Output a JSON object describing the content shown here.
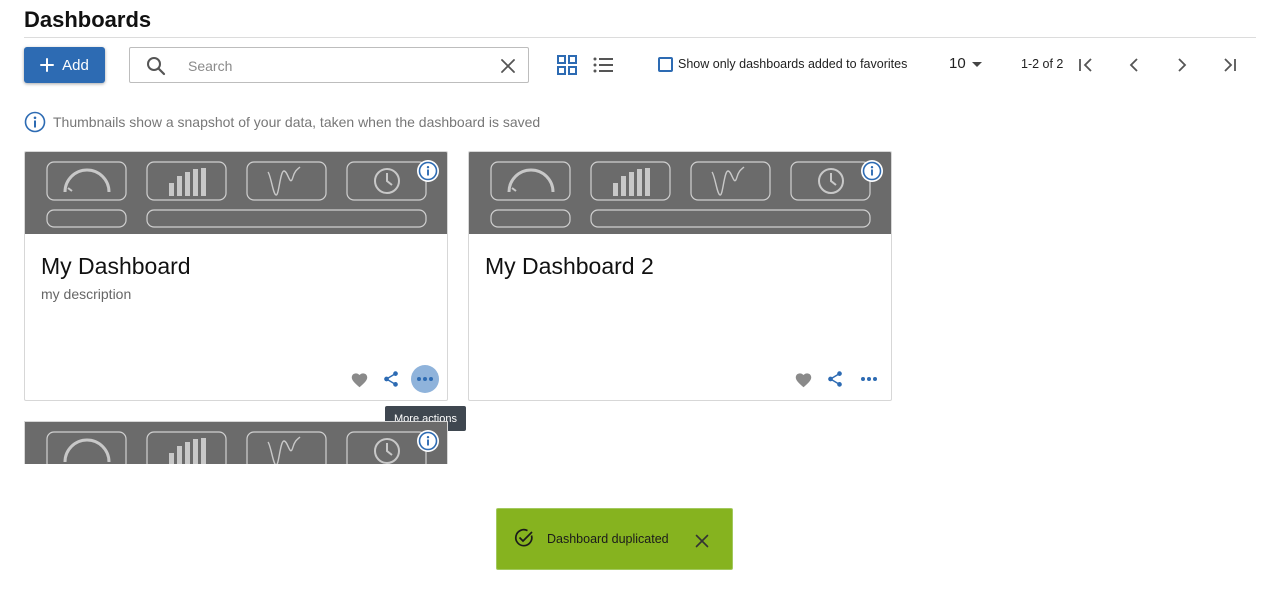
{
  "header": {
    "title": "Dashboards"
  },
  "toolbar": {
    "add_label": "Add",
    "search_placeholder": "Search",
    "search_value": "",
    "favorites_label": "Show only dashboards added to favorites",
    "favorites_checked": false,
    "page_size": "10",
    "page_range": "1-2 of 2"
  },
  "info": {
    "text": "Thumbnails show a snapshot of your data, taken when the dashboard is saved"
  },
  "cards": [
    {
      "title": "My Dashboard",
      "description": "my description",
      "favorited": false
    },
    {
      "title": "My Dashboard 2",
      "description": "",
      "favorited": false
    }
  ],
  "tooltip": {
    "text": "More actions"
  },
  "toast": {
    "text": "Dashboard duplicated"
  },
  "colors": {
    "primary": "#2d6bb3",
    "thumbnail_bg": "#6b6b6b",
    "toast_bg": "#86b31f",
    "active_action_bg": "#8fb3db",
    "tooltip_bg": "#3f4750"
  },
  "icons": [
    "plus-icon",
    "search-icon",
    "clear-icon",
    "grid-view-icon",
    "list-view-icon",
    "first-page-icon",
    "prev-page-icon",
    "next-page-icon",
    "last-page-icon",
    "info-icon",
    "heart-icon",
    "share-icon",
    "more-icon",
    "check-circle-icon",
    "close-icon",
    "gauge-icon",
    "bar-chart-icon",
    "wave-icon",
    "clock-icon"
  ]
}
